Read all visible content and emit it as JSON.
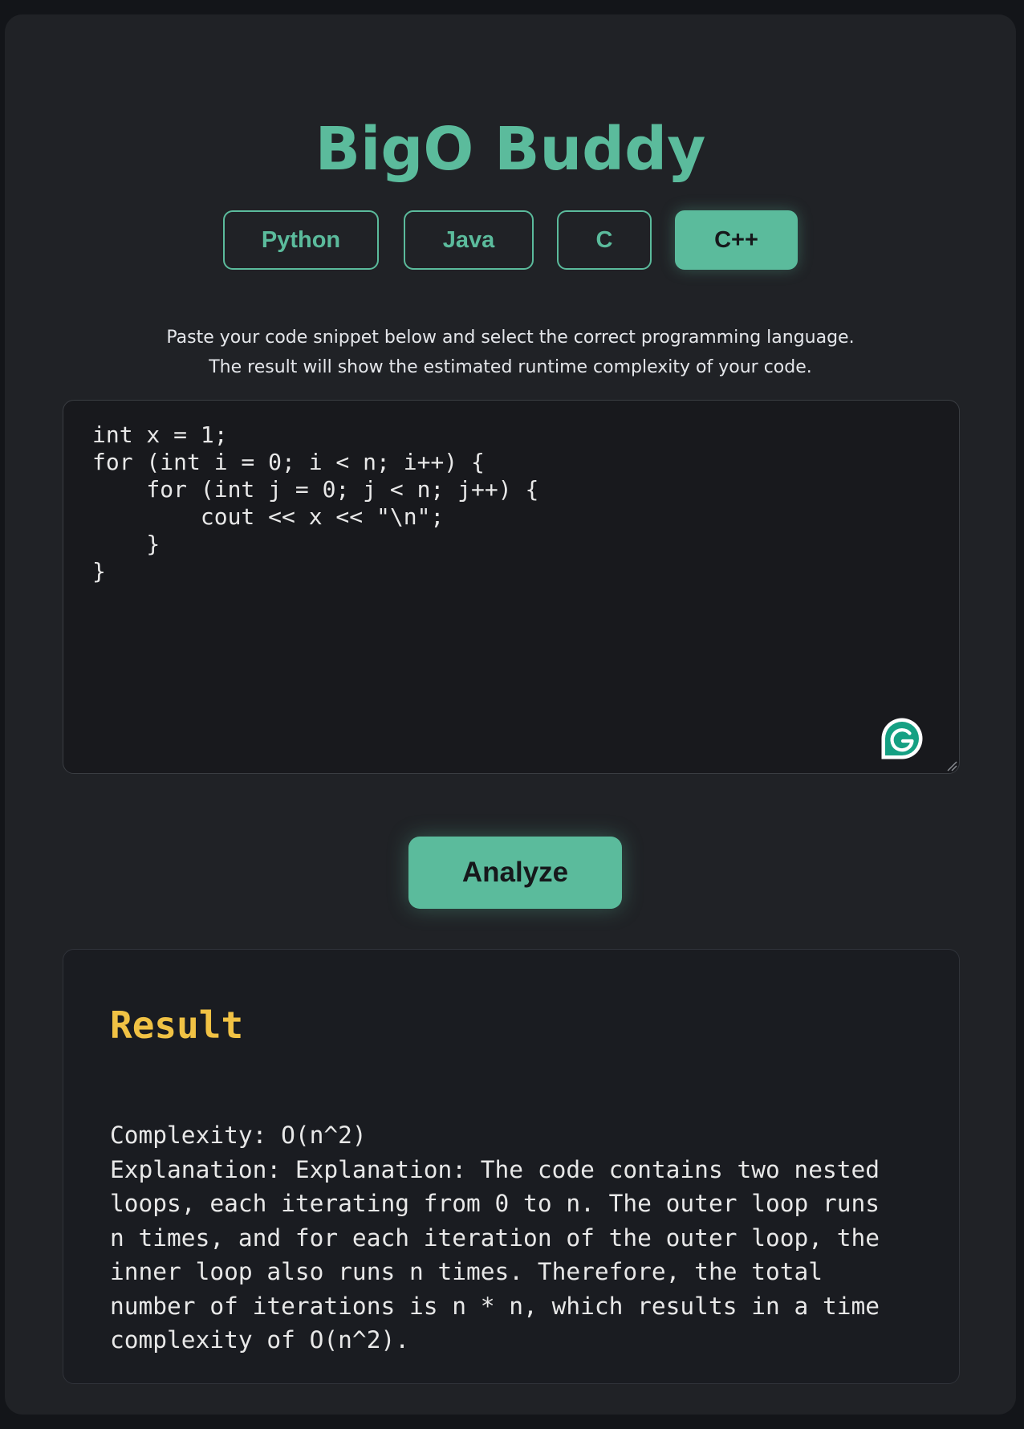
{
  "app": {
    "title": "BigO Buddy"
  },
  "languages": [
    {
      "label": "Python",
      "active": false
    },
    {
      "label": "Java",
      "active": false
    },
    {
      "label": "C",
      "active": false
    },
    {
      "label": "C++",
      "active": true
    }
  ],
  "description": {
    "line1": "Paste your code snippet below and select the correct programming language.",
    "line2": "The result will show the estimated runtime complexity of your code."
  },
  "editor": {
    "code": "int x = 1;\nfor (int i = 0; i < n; i++) {\n    for (int j = 0; j < n; j++) {\n        cout << x << \"\\n\";\n    }\n}"
  },
  "analyze_button": {
    "label": "Analyze"
  },
  "result": {
    "heading": "Result",
    "lines": [
      "Complexity: O(n^2)",
      "Explanation: Explanation: The code contains two nested",
      "loops, each iterating from 0 to n. The outer loop runs",
      "n times, and for each iteration of the outer loop, the",
      "inner loop also runs n times. Therefore, the total",
      "number of iterations is n * n, which results in a time",
      "complexity of O(n^2)."
    ]
  },
  "colors": {
    "accent": "#5bbb9c",
    "result_heading": "#f1c244",
    "page_bg": "#131519",
    "card_bg": "#202226",
    "editor_bg": "#18191d"
  },
  "icons": {
    "grammarly": "grammarly-icon",
    "resize": "resize-handle-icon"
  }
}
